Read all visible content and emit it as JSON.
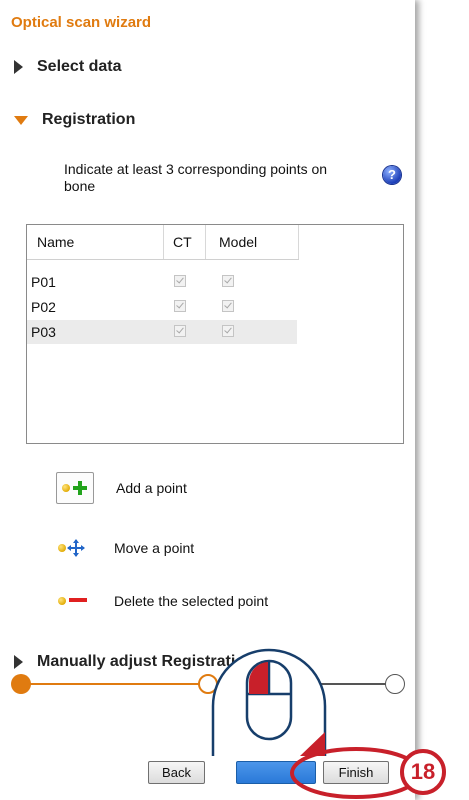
{
  "wizard": {
    "title": "Optical scan wizard"
  },
  "sections": {
    "select_data": "Select data",
    "registration": "Registration",
    "manual_adjust": "Manually adjust Registration"
  },
  "instruction": "Indicate at least 3 corresponding points on bone",
  "help_icon": "question-icon",
  "table": {
    "columns": [
      "Name",
      "CT",
      "Model"
    ],
    "rows": [
      {
        "name": "P01",
        "ct": true,
        "model": true
      },
      {
        "name": "P02",
        "ct": true,
        "model": true
      },
      {
        "name": "P03",
        "ct": true,
        "model": true
      }
    ]
  },
  "tools": {
    "add": "Add a point",
    "move": "Move a point",
    "delete": "Delete the selected point"
  },
  "buttons": {
    "back": "Back",
    "next": "",
    "finish": "Finish"
  },
  "callout": {
    "step_number": "18"
  },
  "colors": {
    "accent": "#e07b10",
    "callout": "#c8202a",
    "next_button": "#2a79d8",
    "mouse_outline": "#173e6b"
  }
}
